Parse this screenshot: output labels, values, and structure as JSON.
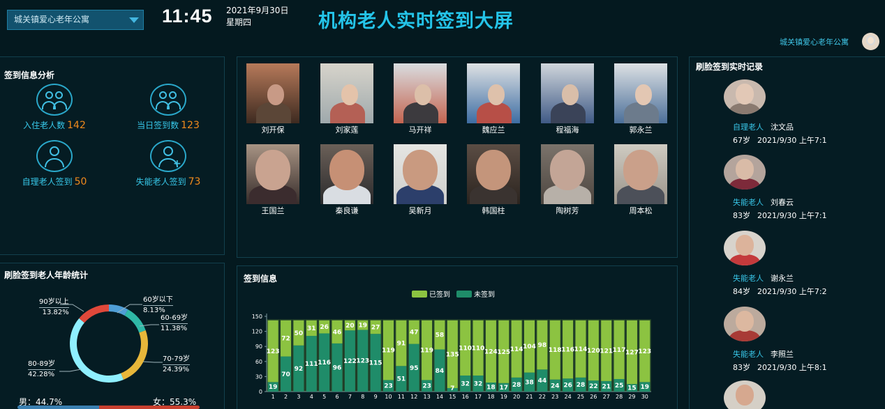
{
  "header": {
    "org_select": "城关镇爱心老年公寓",
    "time": "11:45",
    "date": "2021年9月30日",
    "weekday": "星期四",
    "title": "机构老人实时签到大屏",
    "org_name": "城关镇爱心老年公寓"
  },
  "stats": {
    "title": "签到信息分析",
    "items": [
      {
        "label": "入住老人数",
        "value": "142",
        "icon": "people-icon"
      },
      {
        "label": "当日签到数",
        "value": "123",
        "icon": "people-icon"
      },
      {
        "label": "自理老人签到",
        "value": "50",
        "icon": "person-walker-icon"
      },
      {
        "label": "失能老人签到",
        "value": "73",
        "icon": "person-plus-icon"
      }
    ]
  },
  "photos": [
    {
      "name": "刘开保"
    },
    {
      "name": "刘家莲"
    },
    {
      "name": "马开祥"
    },
    {
      "name": "魏应兰"
    },
    {
      "name": "程福海"
    },
    {
      "name": "郭永兰"
    },
    {
      "name": "王国兰"
    },
    {
      "name": "秦良谦"
    },
    {
      "name": "吴新月"
    },
    {
      "name": "韩国柱"
    },
    {
      "name": "陶树芳"
    },
    {
      "name": "周本松"
    }
  ],
  "age": {
    "title": "刷脸签到老人年龄统计",
    "slices": [
      {
        "label": "60岁以下",
        "pct": "8.13%",
        "value": 8.13,
        "color": "#4f9ed6"
      },
      {
        "label": "60-69岁",
        "pct": "11.38%",
        "value": 11.38,
        "color": "#2fb8a6"
      },
      {
        "label": "70-79岁",
        "pct": "24.39%",
        "value": 24.39,
        "color": "#e8b73a"
      },
      {
        "label": "80-89岁",
        "pct": "42.28%",
        "value": 42.28,
        "color": "#8fefff"
      },
      {
        "label": "90岁以上",
        "pct": "13.82%",
        "value": 13.82,
        "color": "#e0483a"
      }
    ],
    "male": "男：44.7%",
    "female": "女：55.3%",
    "male_value": 44.7,
    "female_value": 55.3
  },
  "records": {
    "title": "刷脸签到实时记录",
    "items": [
      {
        "type": "自理老人",
        "name": "沈文品",
        "age": "67岁",
        "time": "2021/9/30 上午7:1"
      },
      {
        "type": "失能老人",
        "name": "刘春云",
        "age": "83岁",
        "time": "2021/9/30 上午7:1"
      },
      {
        "type": "失能老人",
        "name": "谢永兰",
        "age": "84岁",
        "time": "2021/9/30 上午7:2"
      },
      {
        "type": "失能老人",
        "name": "李照兰",
        "age": "83岁",
        "time": "2021/9/30 上午8:1"
      }
    ]
  },
  "chart_data": {
    "type": "bar",
    "title": "签到信息",
    "stacked": true,
    "categories": [
      "1",
      "2",
      "3",
      "4",
      "5",
      "6",
      "7",
      "8",
      "9",
      "10",
      "11",
      "12",
      "13",
      "14",
      "15",
      "16",
      "17",
      "18",
      "19",
      "20",
      "21",
      "22",
      "23",
      "24",
      "25",
      "26",
      "27",
      "28",
      "29",
      "30"
    ],
    "series": [
      {
        "name": "已签到",
        "color": "#8cc341",
        "values": [
          123,
          72,
          50,
          31,
          26,
          46,
          20,
          19,
          27,
          119,
          91,
          47,
          119,
          58,
          135,
          110,
          110,
          124,
          125,
          114,
          104,
          98,
          118,
          116,
          114,
          120,
          121,
          117,
          127,
          123
        ]
      },
      {
        "name": "未签到",
        "color": "#1f8c69",
        "values": [
          19,
          70,
          92,
          111,
          116,
          96,
          122,
          123,
          115,
          23,
          51,
          95,
          23,
          84,
          7,
          32,
          32,
          18,
          17,
          28,
          38,
          44,
          24,
          26,
          28,
          22,
          21,
          25,
          15,
          19
        ]
      }
    ],
    "yticks": [
      0,
      30,
      60,
      90,
      120,
      150
    ],
    "ylim": [
      0,
      150
    ],
    "grid": false,
    "legend": "top-center"
  }
}
